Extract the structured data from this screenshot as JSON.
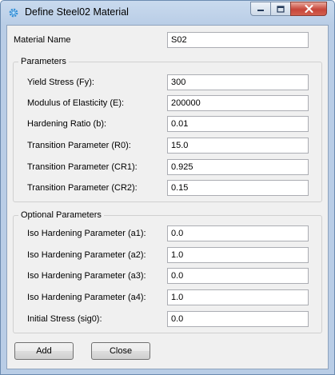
{
  "window": {
    "title": "Define Steel02 Material"
  },
  "material_name": {
    "label": "Material Name",
    "value": "S02"
  },
  "parameters": {
    "title": "Parameters",
    "fields": [
      {
        "label": "Yield Stress (Fy):",
        "value": "300"
      },
      {
        "label": "Modulus of Elasticity (E):",
        "value": "200000"
      },
      {
        "label": "Hardening Ratio (b):",
        "value": "0.01"
      },
      {
        "label": "Transition Parameter (R0):",
        "value": "15.0"
      },
      {
        "label": "Transition Parameter (CR1):",
        "value": "0.925"
      },
      {
        "label": "Transition Parameter (CR2):",
        "value": "0.15"
      }
    ]
  },
  "optional_parameters": {
    "title": "Optional Parameters",
    "fields": [
      {
        "label": "Iso Hardening Parameter (a1):",
        "value": "0.0"
      },
      {
        "label": "Iso Hardening Parameter (a2):",
        "value": "1.0"
      },
      {
        "label": "Iso Hardening Parameter (a3):",
        "value": "0.0"
      },
      {
        "label": "Iso Hardening Parameter (a4):",
        "value": "1.0"
      },
      {
        "label": "Initial Stress (sig0):",
        "value": "0.0"
      }
    ]
  },
  "buttons": {
    "add": "Add",
    "close": "Close"
  }
}
